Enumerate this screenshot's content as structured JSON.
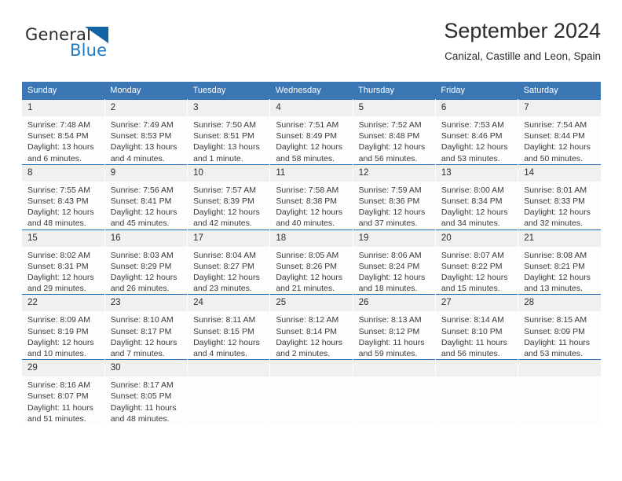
{
  "logo": {
    "text_primary": "General",
    "text_secondary": "Blue",
    "icon": "triangle-icon",
    "color_primary": "#2b2b2b",
    "color_secondary": "#1f7ac4",
    "color_triangle": "#1464a5"
  },
  "header": {
    "title": "September 2024",
    "subtitle": "Canizal, Castille and Leon, Spain"
  },
  "colors": {
    "header_row": "#3b77b5",
    "daynum_band": "#f0f0f0",
    "cell_border": "#1f6bb0",
    "text": "#2d2d2d"
  },
  "weekdays": [
    "Sunday",
    "Monday",
    "Tuesday",
    "Wednesday",
    "Thursday",
    "Friday",
    "Saturday"
  ],
  "weeks": [
    [
      {
        "day": "1",
        "sunrise": "Sunrise: 7:48 AM",
        "sunset": "Sunset: 8:54 PM",
        "daylight": "Daylight: 13 hours and 6 minutes."
      },
      {
        "day": "2",
        "sunrise": "Sunrise: 7:49 AM",
        "sunset": "Sunset: 8:53 PM",
        "daylight": "Daylight: 13 hours and 4 minutes."
      },
      {
        "day": "3",
        "sunrise": "Sunrise: 7:50 AM",
        "sunset": "Sunset: 8:51 PM",
        "daylight": "Daylight: 13 hours and 1 minute."
      },
      {
        "day": "4",
        "sunrise": "Sunrise: 7:51 AM",
        "sunset": "Sunset: 8:49 PM",
        "daylight": "Daylight: 12 hours and 58 minutes."
      },
      {
        "day": "5",
        "sunrise": "Sunrise: 7:52 AM",
        "sunset": "Sunset: 8:48 PM",
        "daylight": "Daylight: 12 hours and 56 minutes."
      },
      {
        "day": "6",
        "sunrise": "Sunrise: 7:53 AM",
        "sunset": "Sunset: 8:46 PM",
        "daylight": "Daylight: 12 hours and 53 minutes."
      },
      {
        "day": "7",
        "sunrise": "Sunrise: 7:54 AM",
        "sunset": "Sunset: 8:44 PM",
        "daylight": "Daylight: 12 hours and 50 minutes."
      }
    ],
    [
      {
        "day": "8",
        "sunrise": "Sunrise: 7:55 AM",
        "sunset": "Sunset: 8:43 PM",
        "daylight": "Daylight: 12 hours and 48 minutes."
      },
      {
        "day": "9",
        "sunrise": "Sunrise: 7:56 AM",
        "sunset": "Sunset: 8:41 PM",
        "daylight": "Daylight: 12 hours and 45 minutes."
      },
      {
        "day": "10",
        "sunrise": "Sunrise: 7:57 AM",
        "sunset": "Sunset: 8:39 PM",
        "daylight": "Daylight: 12 hours and 42 minutes."
      },
      {
        "day": "11",
        "sunrise": "Sunrise: 7:58 AM",
        "sunset": "Sunset: 8:38 PM",
        "daylight": "Daylight: 12 hours and 40 minutes."
      },
      {
        "day": "12",
        "sunrise": "Sunrise: 7:59 AM",
        "sunset": "Sunset: 8:36 PM",
        "daylight": "Daylight: 12 hours and 37 minutes."
      },
      {
        "day": "13",
        "sunrise": "Sunrise: 8:00 AM",
        "sunset": "Sunset: 8:34 PM",
        "daylight": "Daylight: 12 hours and 34 minutes."
      },
      {
        "day": "14",
        "sunrise": "Sunrise: 8:01 AM",
        "sunset": "Sunset: 8:33 PM",
        "daylight": "Daylight: 12 hours and 32 minutes."
      }
    ],
    [
      {
        "day": "15",
        "sunrise": "Sunrise: 8:02 AM",
        "sunset": "Sunset: 8:31 PM",
        "daylight": "Daylight: 12 hours and 29 minutes."
      },
      {
        "day": "16",
        "sunrise": "Sunrise: 8:03 AM",
        "sunset": "Sunset: 8:29 PM",
        "daylight": "Daylight: 12 hours and 26 minutes."
      },
      {
        "day": "17",
        "sunrise": "Sunrise: 8:04 AM",
        "sunset": "Sunset: 8:27 PM",
        "daylight": "Daylight: 12 hours and 23 minutes."
      },
      {
        "day": "18",
        "sunrise": "Sunrise: 8:05 AM",
        "sunset": "Sunset: 8:26 PM",
        "daylight": "Daylight: 12 hours and 21 minutes."
      },
      {
        "day": "19",
        "sunrise": "Sunrise: 8:06 AM",
        "sunset": "Sunset: 8:24 PM",
        "daylight": "Daylight: 12 hours and 18 minutes."
      },
      {
        "day": "20",
        "sunrise": "Sunrise: 8:07 AM",
        "sunset": "Sunset: 8:22 PM",
        "daylight": "Daylight: 12 hours and 15 minutes."
      },
      {
        "day": "21",
        "sunrise": "Sunrise: 8:08 AM",
        "sunset": "Sunset: 8:21 PM",
        "daylight": "Daylight: 12 hours and 13 minutes."
      }
    ],
    [
      {
        "day": "22",
        "sunrise": "Sunrise: 8:09 AM",
        "sunset": "Sunset: 8:19 PM",
        "daylight": "Daylight: 12 hours and 10 minutes."
      },
      {
        "day": "23",
        "sunrise": "Sunrise: 8:10 AM",
        "sunset": "Sunset: 8:17 PM",
        "daylight": "Daylight: 12 hours and 7 minutes."
      },
      {
        "day": "24",
        "sunrise": "Sunrise: 8:11 AM",
        "sunset": "Sunset: 8:15 PM",
        "daylight": "Daylight: 12 hours and 4 minutes."
      },
      {
        "day": "25",
        "sunrise": "Sunrise: 8:12 AM",
        "sunset": "Sunset: 8:14 PM",
        "daylight": "Daylight: 12 hours and 2 minutes."
      },
      {
        "day": "26",
        "sunrise": "Sunrise: 8:13 AM",
        "sunset": "Sunset: 8:12 PM",
        "daylight": "Daylight: 11 hours and 59 minutes."
      },
      {
        "day": "27",
        "sunrise": "Sunrise: 8:14 AM",
        "sunset": "Sunset: 8:10 PM",
        "daylight": "Daylight: 11 hours and 56 minutes."
      },
      {
        "day": "28",
        "sunrise": "Sunrise: 8:15 AM",
        "sunset": "Sunset: 8:09 PM",
        "daylight": "Daylight: 11 hours and 53 minutes."
      }
    ],
    [
      {
        "day": "29",
        "sunrise": "Sunrise: 8:16 AM",
        "sunset": "Sunset: 8:07 PM",
        "daylight": "Daylight: 11 hours and 51 minutes."
      },
      {
        "day": "30",
        "sunrise": "Sunrise: 8:17 AM",
        "sunset": "Sunset: 8:05 PM",
        "daylight": "Daylight: 11 hours and 48 minutes."
      },
      {
        "day": "",
        "sunrise": "",
        "sunset": "",
        "daylight": ""
      },
      {
        "day": "",
        "sunrise": "",
        "sunset": "",
        "daylight": ""
      },
      {
        "day": "",
        "sunrise": "",
        "sunset": "",
        "daylight": ""
      },
      {
        "day": "",
        "sunrise": "",
        "sunset": "",
        "daylight": ""
      },
      {
        "day": "",
        "sunrise": "",
        "sunset": "",
        "daylight": ""
      }
    ]
  ]
}
